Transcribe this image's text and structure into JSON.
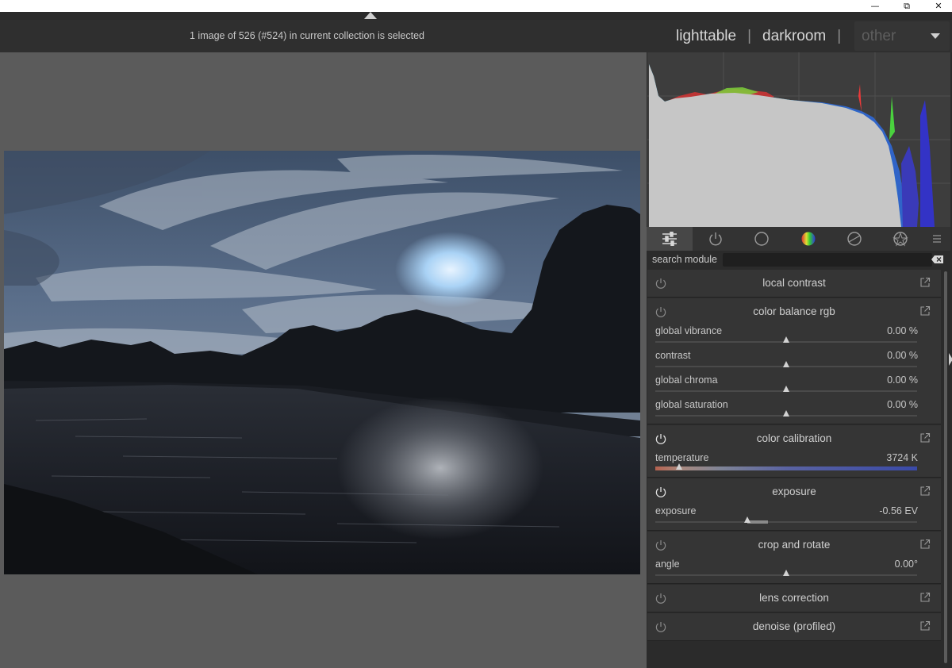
{
  "window": {
    "minimize": "—",
    "maximize": "⧉",
    "close": "✕"
  },
  "header": {
    "status": "1 image of 526 (#524) in current collection is selected",
    "views": {
      "lighttable": "lighttable",
      "sep1": "|",
      "darkroom": "darkroom",
      "sep2": "|",
      "other": "other"
    }
  },
  "module_tabs": [
    {
      "icon": "sliders-icon",
      "active": true
    },
    {
      "icon": "power-icon",
      "active": false
    },
    {
      "icon": "circle-icon",
      "active": false
    },
    {
      "icon": "color-wheel-icon",
      "active": false
    },
    {
      "icon": "correction-icon",
      "active": false
    },
    {
      "icon": "effects-icon",
      "active": false
    },
    {
      "icon": "menu-icon",
      "active": false
    }
  ],
  "search": {
    "label": "search module",
    "value": "",
    "placeholder": ""
  },
  "modules": {
    "local_contrast": {
      "title": "local contrast",
      "enabled": false
    },
    "color_balance_rgb": {
      "title": "color balance rgb",
      "enabled": false,
      "params": [
        {
          "label": "global vibrance",
          "value": "0.00 %",
          "position": 0.5
        },
        {
          "label": "contrast",
          "value": "0.00 %",
          "position": 0.5
        },
        {
          "label": "global chroma",
          "value": "0.00 %",
          "position": 0.5
        },
        {
          "label": "global saturation",
          "value": "0.00 %",
          "position": 0.5
        }
      ]
    },
    "color_calibration": {
      "title": "color calibration",
      "enabled": true,
      "params": [
        {
          "label": "temperature",
          "value": "3724 K",
          "position": 0.09
        }
      ]
    },
    "exposure": {
      "title": "exposure",
      "enabled": true,
      "params": [
        {
          "label": "exposure",
          "value": "-0.56 EV",
          "position": 0.35,
          "default": 0.43
        }
      ]
    },
    "crop_and_rotate": {
      "title": "crop and rotate",
      "enabled": false,
      "params": [
        {
          "label": "angle",
          "value": "0.00°",
          "position": 0.5
        }
      ]
    },
    "lens_correction": {
      "title": "lens correction",
      "enabled": false
    },
    "denoise_profiled": {
      "title": "denoise (profiled)",
      "enabled": false
    }
  },
  "colors": {
    "background": "#5b5b5b",
    "panel": "#2b2b2b",
    "module": "#353535",
    "text": "#c7c7c7"
  }
}
